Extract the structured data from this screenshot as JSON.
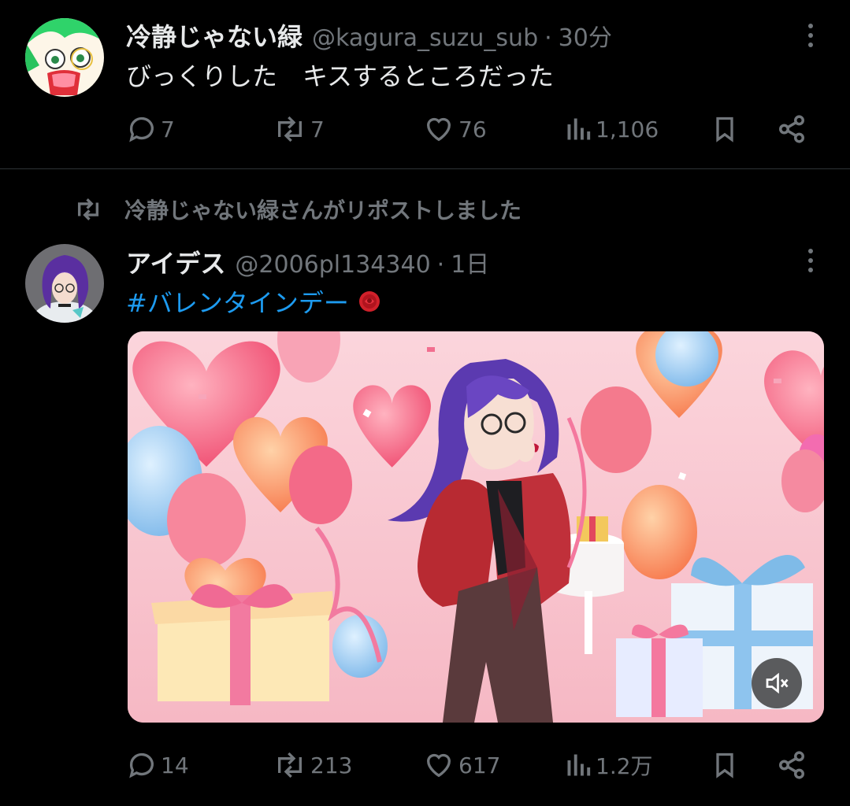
{
  "tweet1": {
    "display_name": "冷静じゃない緑",
    "handle": "@kagura_suzu_sub",
    "separator": "·",
    "time": "30分",
    "text": "びっくりした　キスするところだった",
    "replies": "7",
    "reposts": "7",
    "likes": "76",
    "views": "1,106"
  },
  "repost_banner": {
    "text": "冷静じゃない緑さんがリポストしました"
  },
  "tweet2": {
    "display_name": "アイデス",
    "handle": "@2006pl134340",
    "separator": "·",
    "time": "1日",
    "hashtag": "#バレンタインデー",
    "emoji": "🌹",
    "replies": "14",
    "reposts": "213",
    "likes": "617",
    "views": "1.2万"
  },
  "colors": {
    "background": "#000000",
    "text_primary": "#e7e9ea",
    "text_secondary": "#71767b",
    "link": "#1d9bf0",
    "divider": "#2f3336"
  },
  "icons": [
    "more-icon",
    "reply-icon",
    "repost-icon",
    "like-icon",
    "views-icon",
    "bookmark-icon",
    "share-icon",
    "mute-icon",
    "rose-emoji-icon"
  ]
}
